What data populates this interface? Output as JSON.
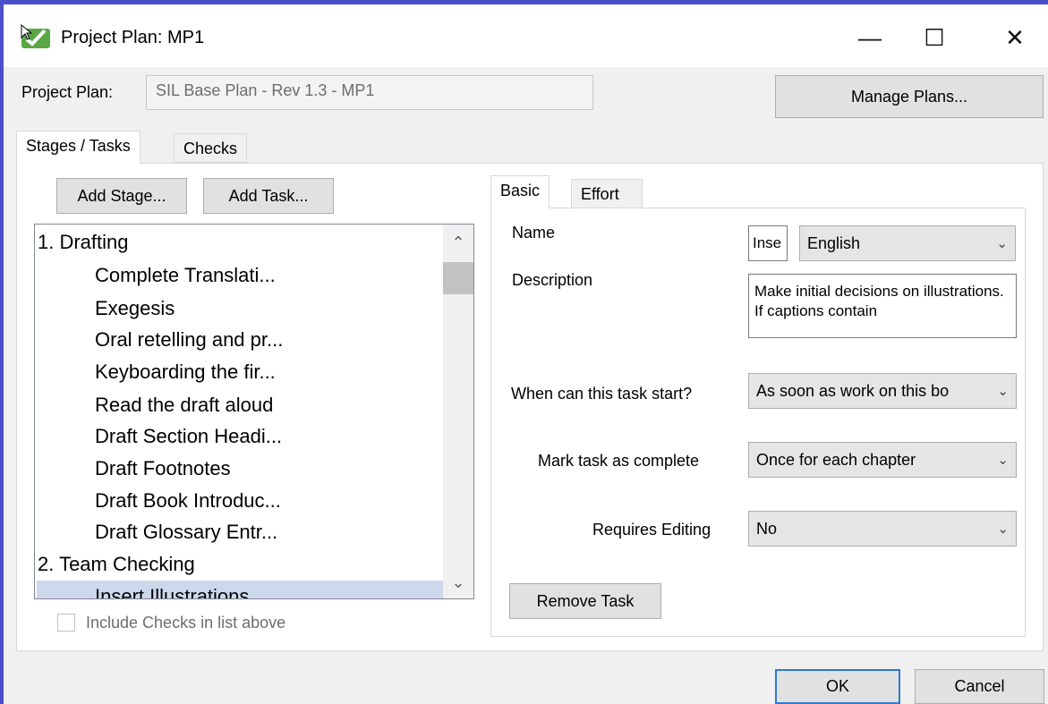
{
  "window": {
    "title": "Project Plan: MP1",
    "minimize": "—",
    "maximize": "☐",
    "close": "✕"
  },
  "plan": {
    "label": "Project Plan:",
    "value": "SIL Base Plan - Rev 1.3 - MP1",
    "manage_button": "Manage Plans..."
  },
  "tabs": [
    {
      "label": "Stages / Tasks",
      "active": true
    },
    {
      "label": "Checks",
      "active": false
    }
  ],
  "left": {
    "add_stage": "Add Stage...",
    "add_task": "Add Task...",
    "tree": [
      {
        "label": "1. Drafting",
        "level": 0
      },
      {
        "label": "Complete Translati...",
        "level": 1
      },
      {
        "label": "Exegesis",
        "level": 1
      },
      {
        "label": "Oral retelling and pr...",
        "level": 1
      },
      {
        "label": "Keyboarding the fir...",
        "level": 1
      },
      {
        "label": "Read the draft aloud",
        "level": 1
      },
      {
        "label": "Draft Section Headi...",
        "level": 1
      },
      {
        "label": "Draft Footnotes",
        "level": 1
      },
      {
        "label": "Draft Book Introduc...",
        "level": 1
      },
      {
        "label": "Draft Glossary Entr...",
        "level": 1
      },
      {
        "label": "2. Team Checking",
        "level": 0
      },
      {
        "label": "Insert Illustrations",
        "level": 1,
        "selected": true
      }
    ],
    "include_checks": "Include Checks in list above",
    "include_checks_checked": false
  },
  "detail_tabs": [
    {
      "label": "Basic",
      "active": true
    },
    {
      "label": "Effort",
      "active": false
    }
  ],
  "basic": {
    "name_label": "Name",
    "name_value": "Inse",
    "language": "English",
    "description_label": "Description",
    "description_value": "Make initial decisions on illustrations. If captions contain",
    "start_label": "When can this task start?",
    "start_value": "As soon as work on this bo",
    "complete_label": "Mark task as complete",
    "complete_value": "Once for each chapter",
    "editing_label": "Requires Editing",
    "editing_value": "No",
    "remove_button": "Remove Task"
  },
  "footer": {
    "ok": "OK",
    "cancel": "Cancel"
  },
  "colors": {
    "accent_border": "#4a4fc9",
    "selection": "#cdd8ec",
    "default_button_border": "#2b79d6"
  }
}
